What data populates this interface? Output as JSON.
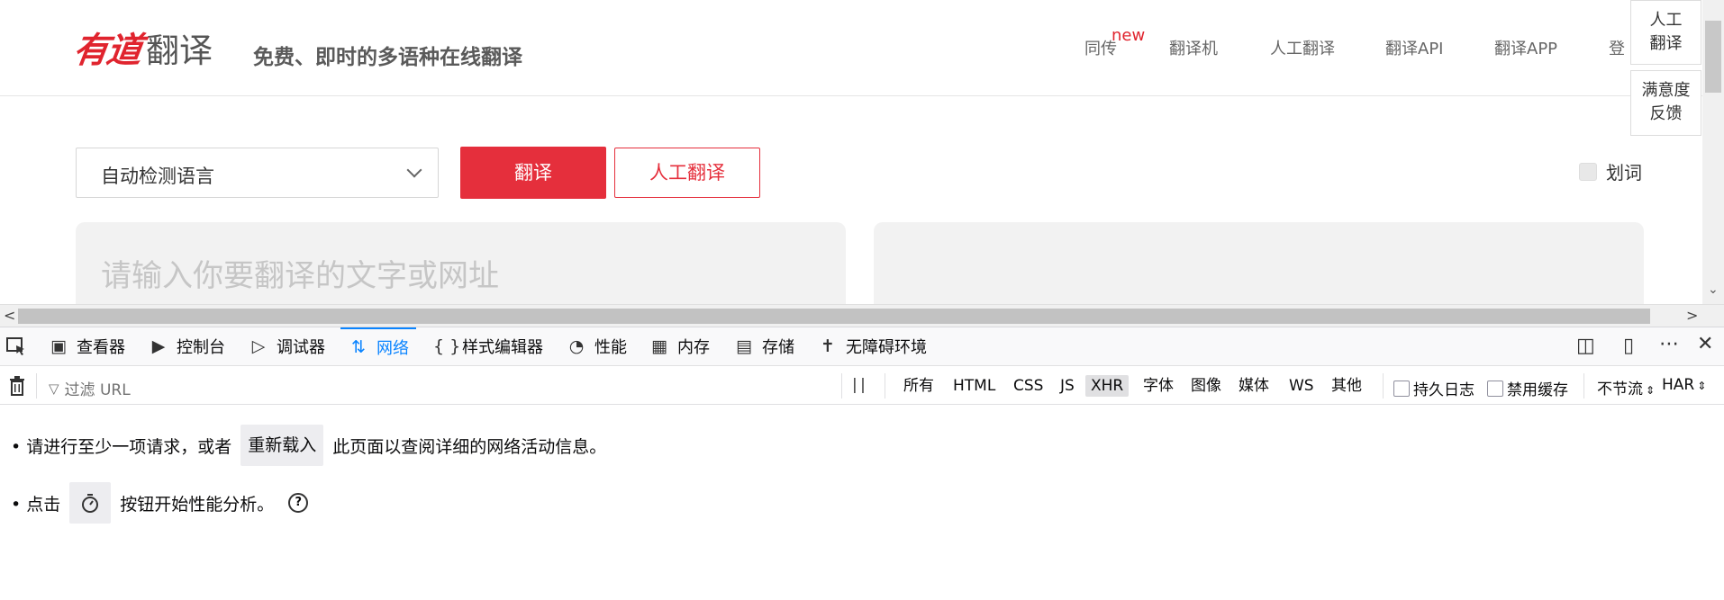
{
  "site": {
    "logo_brand": "有道",
    "logo_product": "翻译",
    "slogan": "免费、即时的多语种在线翻译",
    "nav": [
      {
        "label": "同传"
      },
      {
        "label": "翻译机"
      },
      {
        "label": "人工翻译"
      },
      {
        "label": "翻译API"
      },
      {
        "label": "翻译APP"
      },
      {
        "label": "登"
      }
    ],
    "nav_new_badge": "new",
    "side_human_line1": "人工",
    "side_human_line2": "翻译",
    "side_feedback_line1": "满意度",
    "side_feedback_line2": "反馈",
    "lang_select_value": "自动检测语言",
    "translate_button": "翻译",
    "human_translate_button": "人工翻译",
    "huaci_label": "划词",
    "input_placeholder": "请输入你要翻译的文字或网址",
    "accent_color": "#e52f3c"
  },
  "devtools": {
    "tabs": [
      {
        "label": "查看器",
        "icon": "inspector-icon"
      },
      {
        "label": "控制台",
        "icon": "console-icon"
      },
      {
        "label": "调试器",
        "icon": "debugger-icon"
      },
      {
        "label": "网络",
        "icon": "network-icon",
        "selected": true
      },
      {
        "label": "样式编辑器",
        "icon": "style-editor-icon"
      },
      {
        "label": "性能",
        "icon": "performance-icon"
      },
      {
        "label": "内存",
        "icon": "memory-icon"
      },
      {
        "label": "存储",
        "icon": "storage-icon"
      },
      {
        "label": "无障碍环境",
        "icon": "accessibility-icon"
      }
    ],
    "filter_placeholder": "过滤 URL",
    "filter_types": [
      {
        "label": "所有"
      },
      {
        "label": "HTML"
      },
      {
        "label": "CSS"
      },
      {
        "label": "JS"
      },
      {
        "label": "XHR",
        "active": true
      },
      {
        "label": "字体"
      },
      {
        "label": "图像"
      },
      {
        "label": "媒体"
      },
      {
        "label": "WS"
      },
      {
        "label": "其他"
      }
    ],
    "persist_logs": "持久日志",
    "disable_cache": "禁用缓存",
    "throttle": "不节流",
    "har": "HAR",
    "hint1_before": "• 请进行至少一项请求，或者",
    "hint1_button": "重新载入",
    "hint1_after": "此页面以查阅详细的网络活动信息。",
    "hint2_before": "• 点击",
    "hint2_after": "按钮开始性能分析。",
    "help_glyph": "?",
    "selected_color": "#0a84ff"
  }
}
